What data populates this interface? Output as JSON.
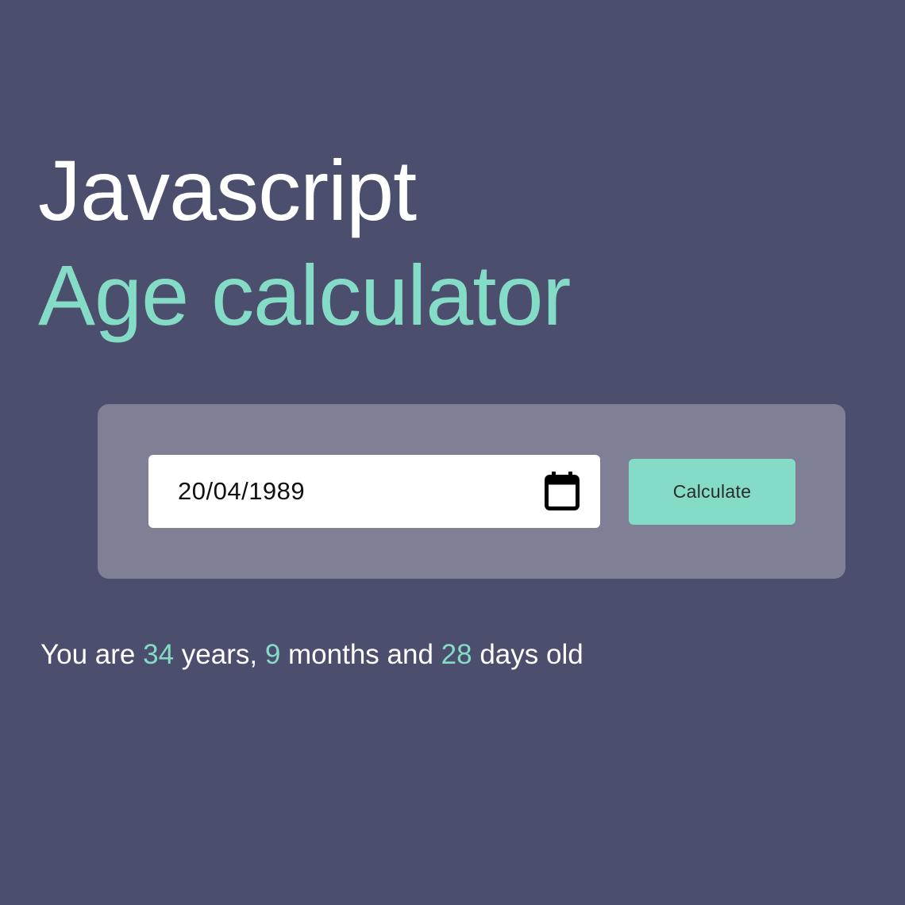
{
  "header": {
    "title_line_1": "Javascript",
    "title_line_2": "Age calculator"
  },
  "form": {
    "date_value": "20/04/1989",
    "calendar_icon": "calendar-icon",
    "button_label": "Calculate"
  },
  "result": {
    "prefix": "You are",
    "years": "34",
    "years_label": "years,",
    "months": "9",
    "months_label": "months and",
    "days": "28",
    "days_label": "days old"
  },
  "colors": {
    "background": "#4b4e6d",
    "accent": "#84dcc6",
    "card": "#7f8096",
    "title": "#ffffff"
  }
}
